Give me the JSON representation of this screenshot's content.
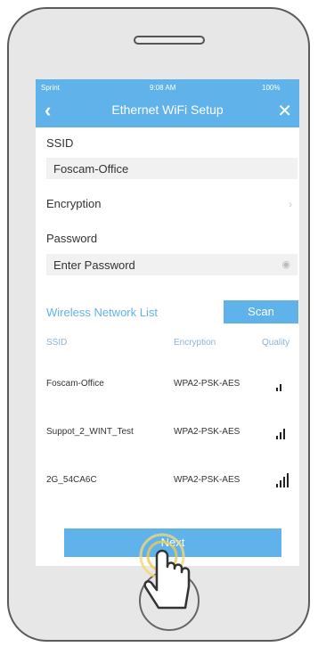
{
  "status_bar": {
    "carrier": "Sprint",
    "time": "9:08 AM",
    "battery": "100%"
  },
  "nav": {
    "title": "Ethernet WiFi Setup"
  },
  "form": {
    "ssid_label": "SSID",
    "ssid_value": "Foscam-Office",
    "encryption_label": "Encryption",
    "password_label": "Password",
    "password_placeholder": "Enter Password"
  },
  "wireless": {
    "title": "Wireless Network List",
    "scan_label": "Scan",
    "columns": {
      "ssid": "SSID",
      "encryption": "Encryption",
      "quality": "Quality"
    },
    "networks": [
      {
        "ssid": "Foscam-Office",
        "encryption": "WPA2-PSK-AES",
        "signal": 2
      },
      {
        "ssid": "Suppot_2_WINT_Test",
        "encryption": "WPA2-PSK-AES",
        "signal": 3
      },
      {
        "ssid": "2G_54CA6C",
        "encryption": "WPA2-PSK-AES",
        "signal": 4
      }
    ]
  },
  "next_label": "Next",
  "colors": {
    "accent": "#5fb3ea"
  }
}
